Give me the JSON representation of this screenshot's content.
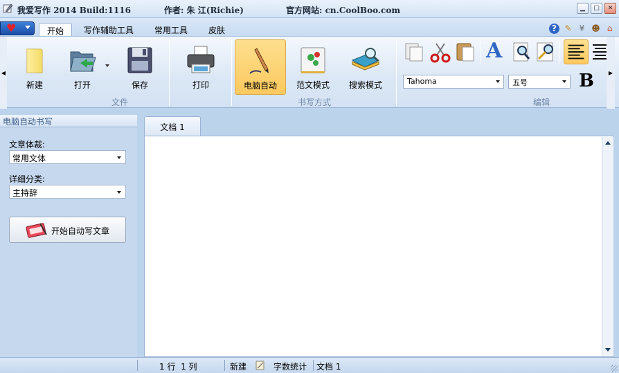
{
  "title": {
    "app": "我爱写作 2014 Build:1116",
    "author": "作者: 朱 江(Richie)",
    "site": "官方网站: cn.CoolBoo.com"
  },
  "menu_tabs": [
    "开始",
    "写作辅助工具",
    "常用工具",
    "皮肤"
  ],
  "ribbon": {
    "file_group": {
      "label": "文件",
      "new": "新建",
      "open": "打开",
      "save": "保存",
      "print": "打印"
    },
    "mode_group": {
      "label": "书写方式",
      "auto": "电脑自动",
      "template": "范文模式",
      "search": "搜索模式"
    },
    "edit_group": {
      "label": "编辑",
      "font": "Tahoma",
      "size": "五号",
      "bold": "B"
    }
  },
  "left_panel": {
    "header": "电脑自动书写",
    "genre_label": "文章体裁:",
    "genre_value": "常用文体",
    "category_label": "详细分类:",
    "category_value": "主持辞",
    "start_button": "开始自动写文章"
  },
  "doc_tab": "文档 1",
  "status": {
    "position": "1 行  1 列",
    "new": "新建",
    "word_count": "字数统计",
    "doc": "文档 1"
  },
  "colors": {
    "accent": "#fcc95e",
    "panel": "#c6d8ee",
    "header_text": "#3b5c8c"
  }
}
